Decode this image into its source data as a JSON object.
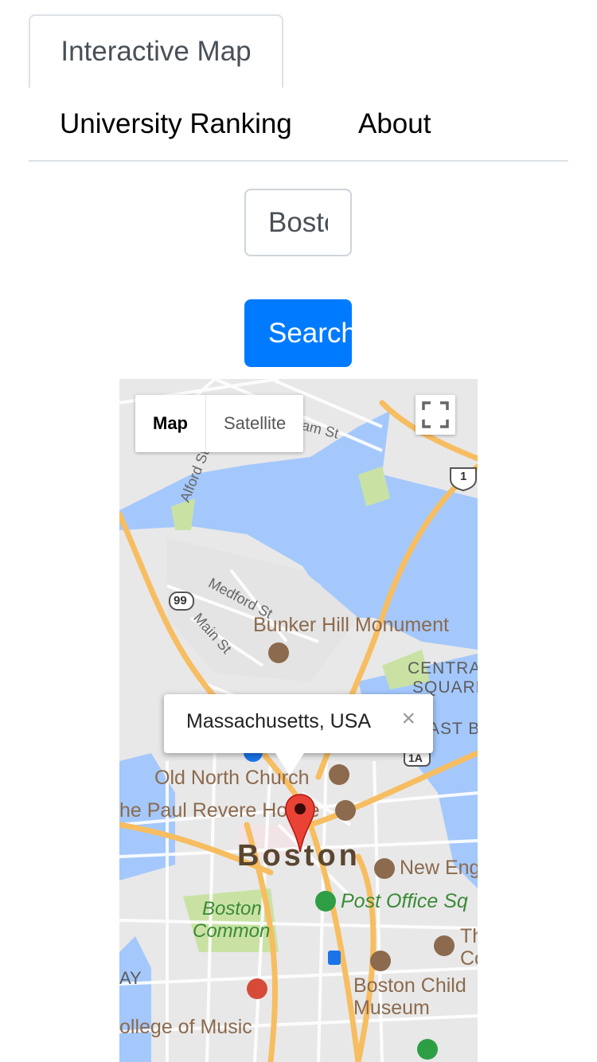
{
  "nav": {
    "tabs": [
      {
        "label": "Interactive Map",
        "active": true
      },
      {
        "label": "University Ranking",
        "active": false
      },
      {
        "label": "About",
        "active": false
      }
    ]
  },
  "search": {
    "value": "Boston",
    "button_label": "Search"
  },
  "map": {
    "type_controls": {
      "map_label": "Map",
      "satellite_label": "Satellite",
      "selected": "Map"
    },
    "fullscreen_icon": "fullscreen-icon",
    "infowindow": {
      "text": "Massachusetts, USA",
      "close_icon": "×"
    },
    "marker_icon": "red-map-pin-icon",
    "labels": {
      "bunker_hill": "Bunker Hill Monument",
      "old_north_church": "Old North Church",
      "paul_revere": "he Paul Revere House",
      "boston": "Boston",
      "new_england": "New Eng",
      "post_office_square": "Post Office Sq",
      "boston_common_1": "Boston",
      "boston_common_2": "Common",
      "boston_children_1": "Boston Child",
      "boston_children_2": "Museum",
      "college_of_music": "ollege of Music",
      "central_square_1": "CENTRA",
      "central_square_2": "SQUARE /",
      "east_boston": "AST B",
      "ay": "AY",
      "th": "Th",
      "co": "Co",
      "medford_st": "Medford St",
      "main_st": "Main St",
      "alford_st": "Alford St",
      "am_st": "am St",
      "route_99": "99",
      "route_1": "1",
      "route_1a": "1A"
    },
    "colors": {
      "water": "#a4c8fc",
      "park": "#c9e2a4",
      "highway": "#f7bd61",
      "land": "#e8e8e8"
    }
  }
}
